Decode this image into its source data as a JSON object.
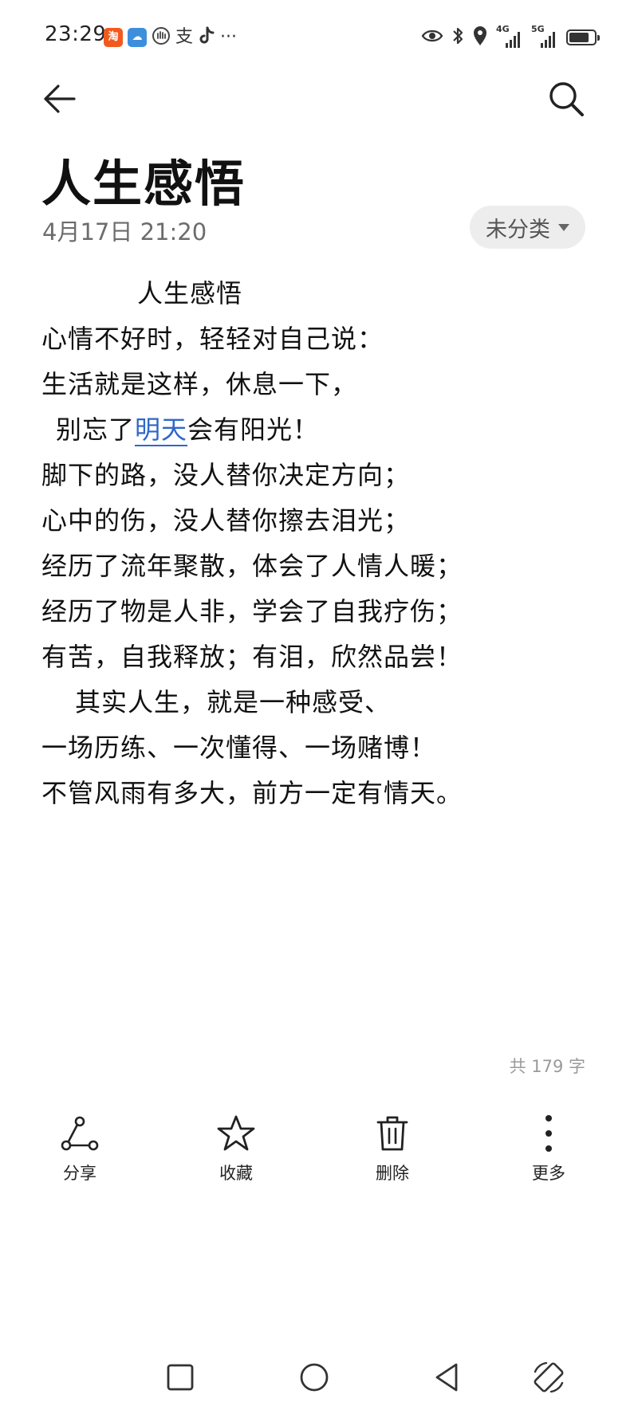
{
  "status_bar": {
    "time": "23:29",
    "app_icons": [
      "taobao-icon",
      "weather-icon",
      "hand-icon",
      "alipay-icon",
      "tiktok-icon"
    ],
    "alipay_glyph": "支",
    "more_glyph": "···",
    "signal_1_label": "4G",
    "signal_2_label": "5G",
    "battery_level": 0.8
  },
  "header": {
    "back_icon": "arrow-left-icon",
    "search_icon": "search-icon"
  },
  "note": {
    "title": "人生感悟",
    "date": "4月17日 21:20",
    "category": "未分类",
    "lines": {
      "l1": "人生感悟",
      "l2": "心情不好时，轻轻对自己说：",
      "l3": "生活就是这样，休息一下，",
      "l4_before": "别忘了",
      "l4_link": "明天",
      "l4_after": "会有阳光！",
      "l5": "脚下的路，没人替你决定方向；",
      "l6": "心中的伤，没人替你擦去泪光；",
      "l7": "经历了流年聚散，体会了人情人暖；",
      "l8": "经历了物是人非，学会了自我疗伤；",
      "l9": "有苦，自我释放；有泪，欣然品尝！",
      "l10": "其实人生，就是一种感受、",
      "l11": "一场历练、一次懂得、一场赌博！",
      "l12": "不管风雨有多大，前方一定有情天。"
    },
    "word_count": "共 179 字"
  },
  "actions": {
    "share": "分享",
    "favorite": "收藏",
    "delete": "删除",
    "more": "更多"
  },
  "nav": {
    "recents_icon": "square-icon",
    "home_icon": "circle-icon",
    "back_icon": "triangle-back-icon",
    "rotate_icon": "rotate-icon"
  },
  "colors": {
    "link": "#2e67c9",
    "chip_bg": "#ededed",
    "muted_text": "#6c6c6c"
  }
}
